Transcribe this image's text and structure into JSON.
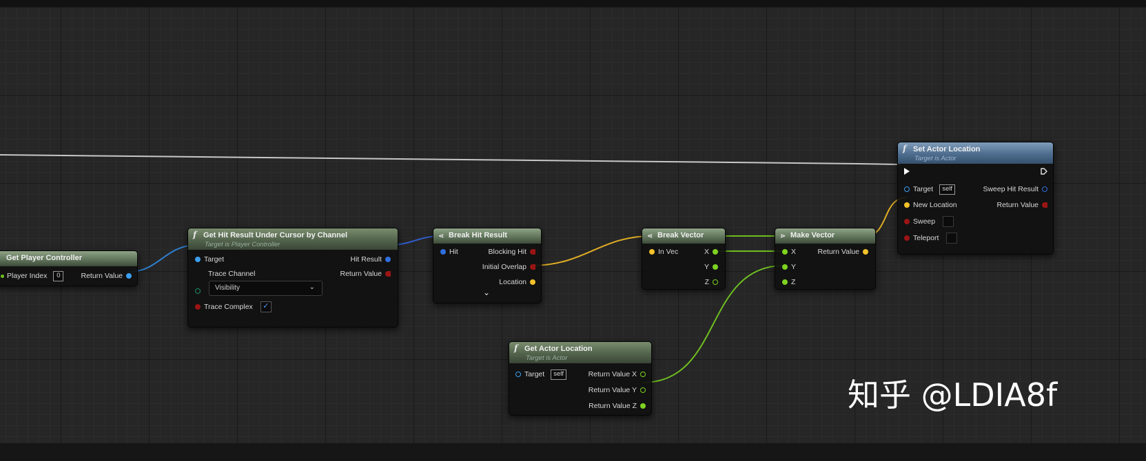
{
  "nodes": {
    "get_player_controller": {
      "title": "Get Player Controller",
      "player_index_label": "Player Index",
      "player_index_value": "0",
      "return_value_label": "Return Value"
    },
    "get_hit_result": {
      "title": "Get Hit Result Under Cursor by Channel",
      "subtitle": "Target is Player Controller",
      "target_label": "Target",
      "trace_channel_label": "Trace Channel",
      "trace_channel_value": "Visibility",
      "trace_complex_label": "Trace Complex",
      "trace_complex_checked": true,
      "hit_result_label": "Hit Result",
      "return_value_label": "Return Value"
    },
    "break_hit_result": {
      "title": "Break Hit Result",
      "hit_label": "Hit",
      "blocking_hit_label": "Blocking Hit",
      "initial_overlap_label": "Initial Overlap",
      "location_label": "Location"
    },
    "break_vector": {
      "title": "Break Vector",
      "in_vec_label": "In Vec",
      "x_label": "X",
      "y_label": "Y",
      "z_label": "Z"
    },
    "make_vector": {
      "title": "Make Vector",
      "x_label": "X",
      "y_label": "Y",
      "z_label": "Z",
      "return_value_label": "Return Value"
    },
    "set_actor_location": {
      "title": "Set Actor Location",
      "subtitle": "Target is Actor",
      "target_label": "Target",
      "target_value": "self",
      "new_location_label": "New Location",
      "sweep_label": "Sweep",
      "teleport_label": "Teleport",
      "sweep_hit_result_label": "Sweep Hit Result",
      "return_value_label": "Return Value"
    },
    "get_actor_location": {
      "title": "Get Actor Location",
      "subtitle": "Target is Actor",
      "target_label": "Target",
      "target_value": "self",
      "return_x_label": "Return Value X",
      "return_y_label": "Return Value Y",
      "return_z_label": "Return Value Z"
    }
  },
  "watermark": "知乎 @LDIA8f",
  "colors": {
    "object_pin": "#3c9ef0",
    "struct_hit_pin": "#2f6fe0",
    "vector_pin": "#f3c12a",
    "float_pin": "#7ed321",
    "bool_pin": "#9b1414",
    "exec_pin": "#ffffff",
    "canvas_bg": "#262626"
  }
}
